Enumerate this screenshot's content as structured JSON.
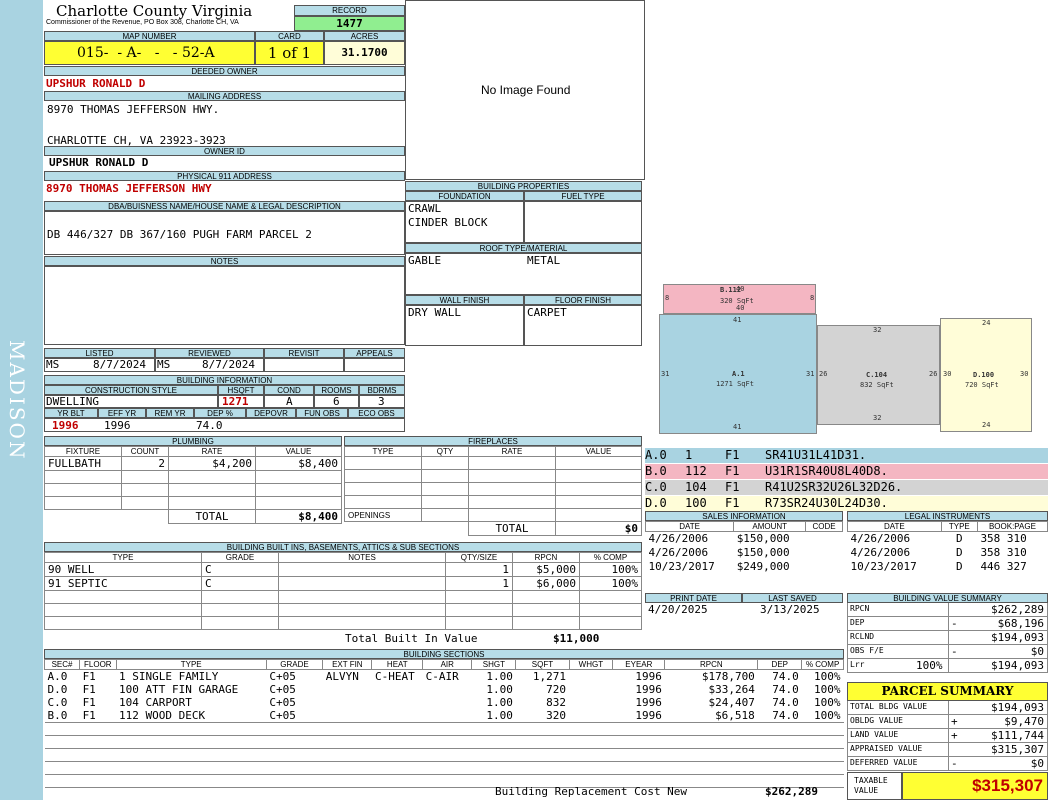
{
  "sidebar": {
    "district": "MADISON"
  },
  "header": {
    "county": "Charlotte County Virginia",
    "commissioner": "Commissioner of the Revenue, PO Box 308, Charlotte CH, VA",
    "record_label": "RECORD",
    "record": "1477",
    "map_label": "MAP NUMBER",
    "map": "015-  - A-   -   - 52-A",
    "card_label": "CARD",
    "card": "1 of 1",
    "acres_label": "ACRES",
    "acres": "31.1700"
  },
  "owner": {
    "deeded_label": "DEEDED OWNER",
    "deeded": "UPSHUR RONALD D",
    "mailing_label": "MAILING ADDRESS",
    "mail1": "8970 THOMAS JEFFERSON HWY.",
    "mail2": "",
    "mail3": "CHARLOTTE CH, VA 23923-3923",
    "ownerid_label": "OWNER ID",
    "ownerid": "UPSHUR RONALD D",
    "phys_label": "PHYSICAL 911 ADDRESS",
    "phys": "8970 THOMAS JEFFERSON HWY",
    "legal_label": "DBA/BUISNESS NAME/HOUSE NAME & LEGAL DESCRIPTION",
    "legal": "DB 446/327 DB 367/160 PUGH FARM PARCEL 2",
    "notes_label": "NOTES"
  },
  "image": {
    "text": "No Image Found"
  },
  "props": {
    "title": "BUILDING PROPERTIES",
    "foundation_label": "FOUNDATION",
    "fuel_label": "FUEL TYPE",
    "foundation1": "CRAWL",
    "foundation2": "CINDER BLOCK",
    "roof_label": "ROOF TYPE/MATERIAL",
    "roof_type": "GABLE",
    "roof_mat": "METAL",
    "wall_label": "WALL FINISH",
    "floor_label": "FLOOR FINISH",
    "wall": "DRY WALL",
    "floor": "CARPET"
  },
  "status": {
    "listed_label": "LISTED",
    "reviewed_label": "REVIEWED",
    "revisit_label": "REVISIT",
    "appeals_label": "APPEALS",
    "listed_by": "MS",
    "listed_date": "8/7/2024",
    "reviewed_by": "MS",
    "reviewed_date": "8/7/2024"
  },
  "building_info": {
    "title": "BUILDING INFORMATION",
    "style_label": "CONSTRUCTION STYLE",
    "hsqft_label": "HSQFT",
    "cond_label": "COND",
    "rooms_label": "ROOMS",
    "bdrms_label": "BDRMS",
    "style": "DWELLING",
    "hsqft": "1271",
    "cond": "A",
    "rooms": "6",
    "bdrms": "3",
    "yrblt_label": "YR BLT",
    "effyr_label": "EFF YR",
    "remyr_label": "REM YR",
    "dep_label": "DEP %",
    "depovr_label": "DEPOVR",
    "funobs_label": "FUN OBS",
    "ecoobs_label": "ECO OBS",
    "yrblt": "1996",
    "effyr": "1996",
    "dep": "74.0"
  },
  "plumbing": {
    "title": "PLUMBING",
    "cols": [
      "FIXTURE",
      "COUNT",
      "RATE",
      "VALUE"
    ],
    "fixture": "FULLBATH",
    "count": "2",
    "rate": "$4,200",
    "value": "$8,400",
    "total_label": "TOTAL",
    "total": "$8,400"
  },
  "fireplaces": {
    "title": "FIREPLACES",
    "cols": [
      "TYPE",
      "QTY",
      "RATE",
      "VALUE"
    ],
    "openings_label": "OPENINGS",
    "total_label": "TOTAL",
    "total": "$0"
  },
  "builtins": {
    "title": "BUILDING BUILT INS, BASEMENTS, ATTICS & SUB SECTIONS",
    "cols": [
      "TYPE",
      "GRADE",
      "NOTES",
      "QTY/SIZE",
      "RPCN",
      "% COMP"
    ],
    "rows": [
      {
        "type": "90 WELL",
        "grade": "C",
        "qty": "1",
        "rpcn": "$5,000",
        "comp": "100%"
      },
      {
        "type": "91 SEPTIC",
        "grade": "C",
        "qty": "1",
        "rpcn": "$6,000",
        "comp": "100%"
      }
    ],
    "total_label": "Total Built In Value",
    "total": "$11,000"
  },
  "sections": {
    "title": "BUILDING SECTIONS",
    "cols": [
      "SEC#",
      "FLOOR",
      "TYPE",
      "GRADE",
      "EXT FIN",
      "HEAT",
      "AIR",
      "SHGT",
      "SQFT",
      "WHGT",
      "EYEAR",
      "RPCN",
      "DEP",
      "% COMP"
    ],
    "rows": [
      {
        "sec": "A.0",
        "floor": "F1",
        "type": "1 SINGLE FAMILY",
        "grade": "C+05",
        "ext": "ALVYN",
        "heat": "C-HEAT",
        "air": "C-AIR",
        "shgt": "1.00",
        "sqft": "1,271",
        "whgt": "",
        "eyear": "1996",
        "rpcn": "$178,700",
        "dep": "74.0",
        "comp": "100%"
      },
      {
        "sec": "D.0",
        "floor": "F1",
        "type": "100 ATT FIN GARAGE",
        "grade": "C+05",
        "ext": "",
        "heat": "",
        "air": "",
        "shgt": "1.00",
        "sqft": "720",
        "whgt": "",
        "eyear": "1996",
        "rpcn": "$33,264",
        "dep": "74.0",
        "comp": "100%"
      },
      {
        "sec": "C.0",
        "floor": "F1",
        "type": "104 CARPORT",
        "grade": "C+05",
        "ext": "",
        "heat": "",
        "air": "",
        "shgt": "1.00",
        "sqft": "832",
        "whgt": "",
        "eyear": "1996",
        "rpcn": "$24,407",
        "dep": "74.0",
        "comp": "100%"
      },
      {
        "sec": "B.0",
        "floor": "F1",
        "type": "112 WOOD DECK",
        "grade": "C+05",
        "ext": "",
        "heat": "",
        "air": "",
        "shgt": "1.00",
        "sqft": "320",
        "whgt": "",
        "eyear": "1996",
        "rpcn": "$6,518",
        "dep": "74.0",
        "comp": "100%"
      }
    ],
    "brcn_label": "Building Replacement Cost New",
    "brcn": "$262,289"
  },
  "sketch": {
    "b_name": "B.112",
    "b_area": "320 SqFt",
    "a_name": "A.1",
    "a_area": "1271 SqFt",
    "c_name": "C.104",
    "c_area": "832 SqFt",
    "d_name": "D.100",
    "d_area": "720 SqFt",
    "b_top": "40",
    "b_bot": "40",
    "b_l": "8",
    "b_r": "8",
    "a_top": "41",
    "a_bot": "41",
    "a_l": "31",
    "a_r": "31",
    "c_top": "32",
    "c_bot": "32",
    "c_l": "26",
    "c_r": "26",
    "d_top": "24",
    "d_bot": "24",
    "d_l": "30",
    "d_r": "30"
  },
  "traverse": [
    {
      "sec": "A.0",
      "code": "1",
      "floor": "F1",
      "path": "SR41U31L41D31.",
      "color": "#a9d3e1"
    },
    {
      "sec": "B.0",
      "code": "112",
      "floor": "F1",
      "path": "U31R1SR40U8L40D8.",
      "color": "#f4b6c2"
    },
    {
      "sec": "C.0",
      "code": "104",
      "floor": "F1",
      "path": "R41U2SR32U26L32D26.",
      "color": "#d3d3d3"
    },
    {
      "sec": "D.0",
      "code": "100",
      "floor": "F1",
      "path": "R73SR24U30L24D30.",
      "color": "#fffdd8"
    }
  ],
  "sales": {
    "title": "SALES INFORMATION",
    "cols": [
      "DATE",
      "AMOUNT",
      "CODE"
    ],
    "rows": [
      {
        "date": "4/26/2006",
        "amount": "$150,000"
      },
      {
        "date": "4/26/2006",
        "amount": "$150,000"
      },
      {
        "date": "10/23/2017",
        "amount": "$249,000"
      }
    ]
  },
  "legal": {
    "title": "LEGAL INSTRUMENTS",
    "cols": [
      "DATE",
      "TYPE",
      "BOOK:PAGE"
    ],
    "rows": [
      {
        "date": "4/26/2006",
        "type": "D",
        "book": "358 310"
      },
      {
        "date": "4/26/2006",
        "type": "D",
        "book": "358 310"
      },
      {
        "date": "10/23/2017",
        "type": "D",
        "book": "446 327"
      }
    ]
  },
  "print": {
    "print_label": "PRINT DATE",
    "saved_label": "LAST SAVED",
    "print": "4/20/2025",
    "saved": "3/13/2025"
  },
  "bvs": {
    "title": "BUILDING VALUE SUMMARY",
    "rows": [
      {
        "label": "RPCN",
        "sign": "",
        "value": "$262,289"
      },
      {
        "label": "DEP",
        "sign": "-",
        "value": "$68,196"
      },
      {
        "label": "RCLND",
        "sign": "",
        "value": "$194,093"
      },
      {
        "label": "OBS F/E",
        "sign": "-",
        "value": "$0"
      },
      {
        "label": "Lrr",
        "pct": "100%",
        "sign": "",
        "value": "$194,093"
      }
    ]
  },
  "parcel": {
    "title": "PARCEL SUMMARY",
    "rows": [
      {
        "label": "TOTAL BLDG VALUE",
        "sign": "",
        "value": "$194,093"
      },
      {
        "label": "OBLDG VALUE",
        "sign": "+",
        "value": "$9,470"
      },
      {
        "label": "LAND VALUE",
        "sign": "+",
        "value": "$111,744"
      },
      {
        "label": "APPRAISED VALUE",
        "sign": "",
        "value": "$315,307"
      },
      {
        "label": "DEFERRED VALUE",
        "sign": "-",
        "value": "$0"
      }
    ],
    "taxable_label1": "TAXABLE",
    "taxable_label2": "VALUE",
    "taxable": "$315,307"
  }
}
